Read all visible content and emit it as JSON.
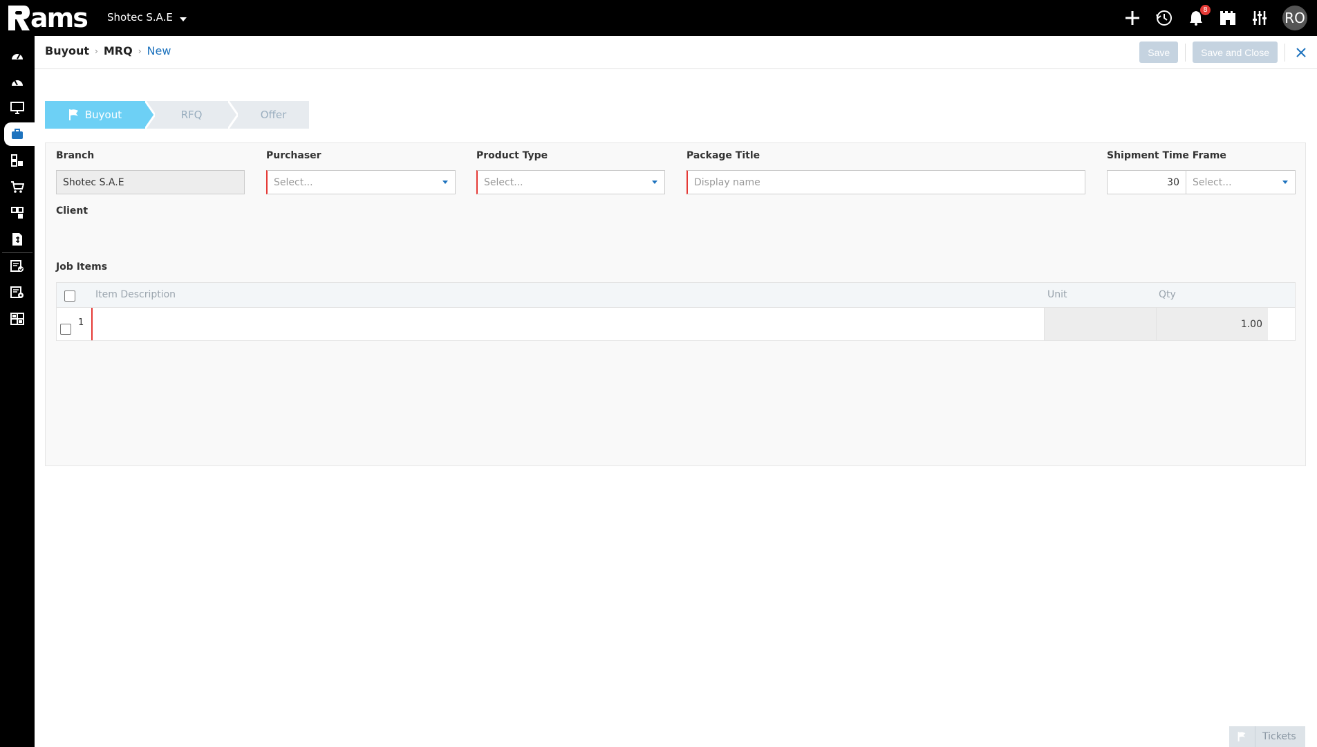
{
  "app": {
    "logo_text": "ams",
    "company": "Shotec S.A.E"
  },
  "topbar": {
    "notifications_count": "8",
    "avatar_initials": "RO"
  },
  "sidebar": {
    "items": [
      {
        "icon": "dashboard-icon"
      },
      {
        "icon": "dashboard-icon"
      },
      {
        "icon": "monitor-icon"
      },
      {
        "icon": "briefcase-icon",
        "active": true
      },
      {
        "icon": "modules-icon"
      },
      {
        "icon": "cart-icon"
      },
      {
        "icon": "modules-icon"
      },
      {
        "icon": "invoice-icon"
      },
      {
        "icon": "document-check-icon"
      },
      {
        "icon": "document-settings-icon"
      },
      {
        "icon": "grid-icon"
      }
    ]
  },
  "breadcrumb": {
    "level1": "Buyout",
    "level2": "MRQ",
    "current": "New"
  },
  "actions": {
    "save": "Save",
    "save_close": "Save and Close"
  },
  "wizard": {
    "steps": [
      "Buyout",
      "RFQ",
      "Offer"
    ]
  },
  "form": {
    "branch": {
      "label": "Branch",
      "value": "Shotec S.A.E"
    },
    "purchaser": {
      "label": "Purchaser",
      "placeholder": "Select..."
    },
    "product_type": {
      "label": "Product Type",
      "placeholder": "Select..."
    },
    "package_title": {
      "label": "Package Title",
      "placeholder": "Display name"
    },
    "shipment": {
      "label": "Shipment Time Frame",
      "value": "30",
      "unit_placeholder": "Select..."
    },
    "client": {
      "label": "Client"
    }
  },
  "job_items": {
    "label": "Job Items",
    "columns": {
      "description": "Item Description",
      "unit": "Unit",
      "qty": "Qty"
    },
    "rows": [
      {
        "num": "1",
        "description": "",
        "unit": "",
        "qty": "1.00"
      }
    ]
  },
  "footer": {
    "tickets": "Tickets"
  }
}
